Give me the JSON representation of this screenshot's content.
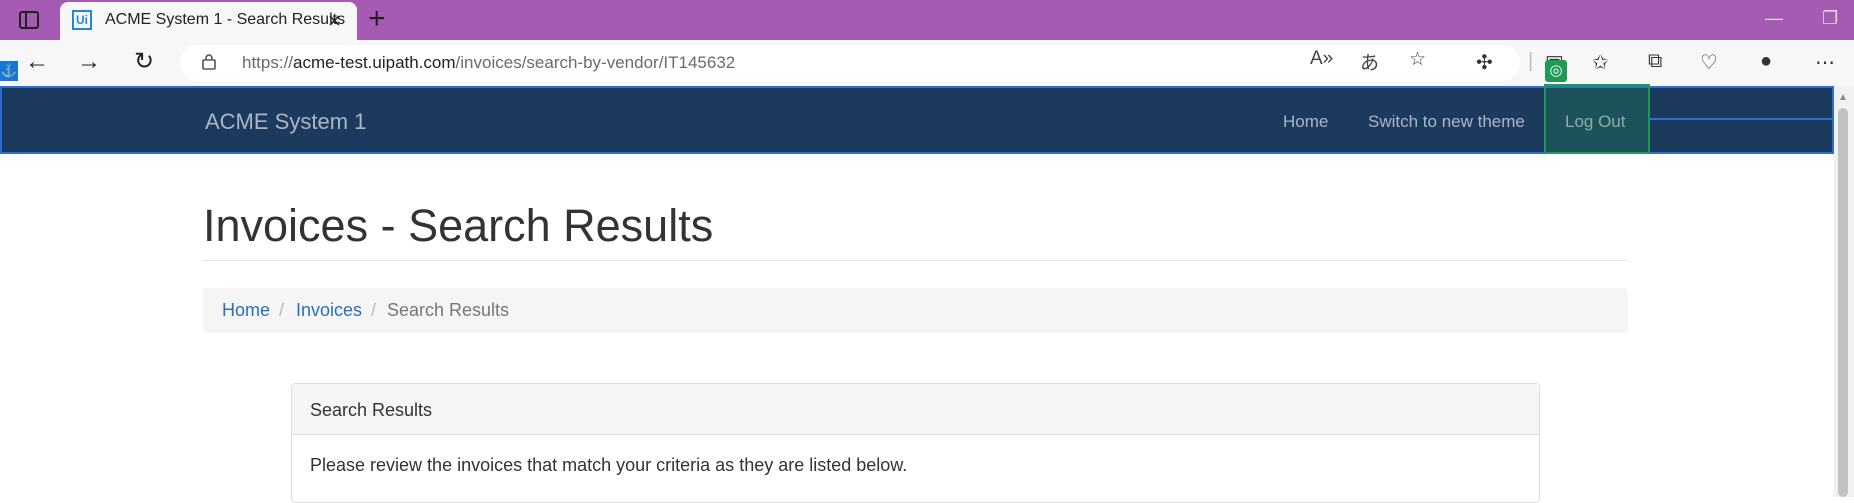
{
  "browser": {
    "tab_title": "ACME System 1 - Search Results",
    "tab_favicon_text": "Ui",
    "url_prefix": "https://",
    "url_host": "acme-test.uipath.com",
    "url_path": "/invoices/search-by-vendor/IT145632"
  },
  "nav": {
    "brand": "ACME System 1",
    "links": [
      "Home",
      "Switch to new theme",
      "Log Out"
    ]
  },
  "page": {
    "title": "Invoices - Search Results",
    "breadcrumb": [
      "Home",
      "Invoices",
      "Search Results"
    ],
    "breadcrumb_separator": "/"
  },
  "panel": {
    "heading": "Search Results",
    "message": "Please review the invoices that match your criteria as they are listed below."
  },
  "colors": {
    "titlebar": "#a55ab4",
    "navbar": "#1c3a5e",
    "link": "#2a6ebb",
    "highlight": "#1f9a55",
    "selection": "#2b6fd6"
  }
}
